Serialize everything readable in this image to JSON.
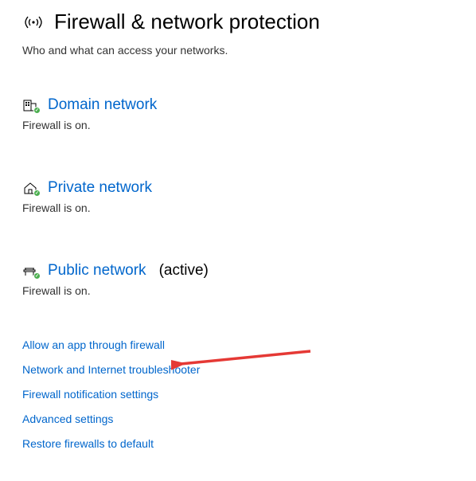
{
  "header": {
    "title": "Firewall & network protection",
    "subtitle": "Who and what can access your networks."
  },
  "networks": {
    "domain": {
      "label": "Domain network",
      "status": "Firewall is on."
    },
    "private": {
      "label": "Private network",
      "status": "Firewall is on."
    },
    "public": {
      "label": "Public network",
      "active_suffix": "(active)",
      "status": "Firewall is on."
    }
  },
  "links": {
    "allow_app": "Allow an app through firewall",
    "troubleshooter": "Network and Internet troubleshooter",
    "notifications": "Firewall notification settings",
    "advanced": "Advanced settings",
    "restore": "Restore firewalls to default"
  },
  "colors": {
    "link": "#0066cc",
    "text": "#333333",
    "success": "#4CAF50",
    "arrow": "#E53935"
  }
}
